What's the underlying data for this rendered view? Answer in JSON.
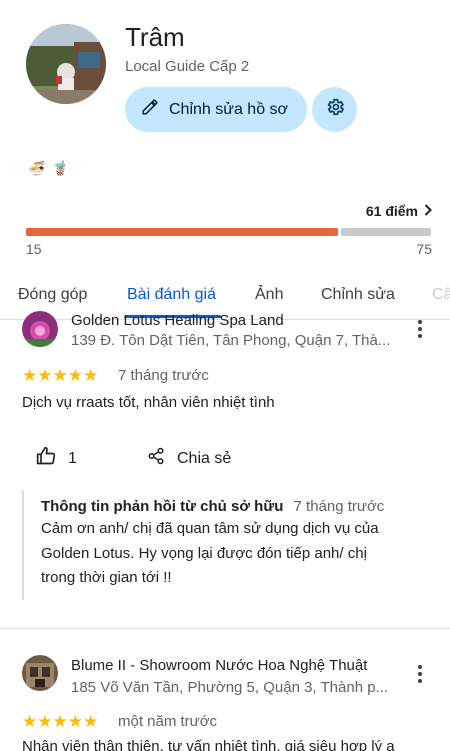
{
  "profile": {
    "name": "Trâm",
    "level": "Local Guide Cấp 2",
    "edit_label": "Chỉnh sửa hồ sơ",
    "badges": [
      "🍜",
      "🧋"
    ]
  },
  "progress": {
    "points_label": "61 điểm",
    "min": "15",
    "max": "75",
    "value": 61,
    "fraction": 0.77
  },
  "tabs": [
    {
      "label": "Đóng góp"
    },
    {
      "label": "Bài đánh giá"
    },
    {
      "label": "Ảnh"
    },
    {
      "label": "Chỉnh sửa"
    },
    {
      "label": "Câ"
    }
  ],
  "reviews": [
    {
      "place": "Golden Lotus Healing Spa Land",
      "address": "139 Đ. Tôn Dật Tiên, Tân Phong, Quận 7, Thà...",
      "rating": 5,
      "stars": "★★★★★",
      "time": "7 tháng trước",
      "text": "Dịch vụ rraats tốt, nhân viên nhiệt tình",
      "likes": "1",
      "share_label": "Chia sẻ",
      "reply": {
        "owner_label": "Thông tin phản hồi từ chủ sở hữu",
        "time": "7 tháng trước",
        "lines": [
          "Cảm ơn anh/ chị đã quan tâm sử dụng dịch vụ của",
          "Golden Lotus. Hy vọng lại được đón tiếp anh/ chị",
          "trong thời gian tới !!"
        ]
      }
    },
    {
      "place": "Blume II - Showroom Nước Hoa Nghệ Thuật",
      "address": "185 Võ Văn Tần, Phường 5, Quận 3, Thành p...",
      "rating": 5,
      "stars": "★★★★★",
      "time": "một năm trước",
      "text": "Nhân viên thân thiện, tư vấn nhiệt tình, giá siêu hợp lý a"
    }
  ],
  "colors": {
    "accent": "#0b57d0",
    "button_bg": "#c2e7ff",
    "progress": "#e8643a",
    "star": "#fbbc04"
  },
  "icons": {
    "edit": "pencil-icon",
    "settings": "gear-icon",
    "like": "thumb-up-icon",
    "share": "share-icon",
    "more": "more-vert-icon",
    "chevron": "chevron-right-icon"
  }
}
